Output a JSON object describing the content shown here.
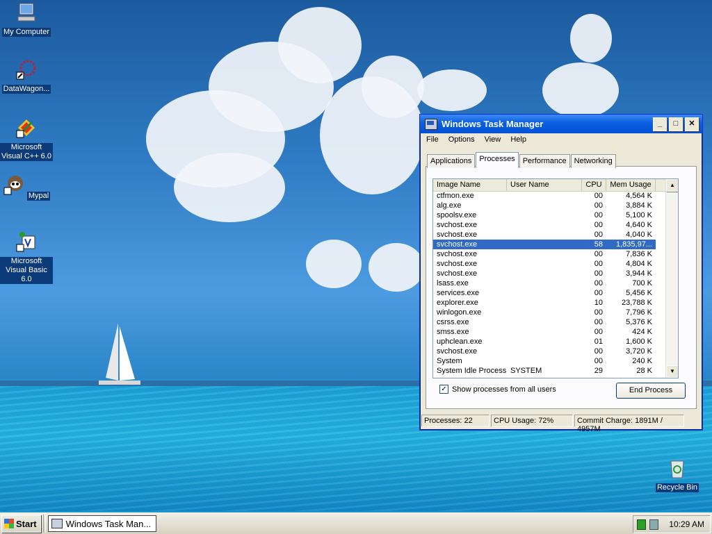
{
  "desktop": {
    "icons": [
      {
        "label": "My Computer"
      },
      {
        "label": "DataWagon..."
      },
      {
        "label": "Microsoft Visual C++ 6.0"
      },
      {
        "label": "Mypal"
      },
      {
        "label": "Microsoft Visual Basic 6.0"
      },
      {
        "label": "Recycle Bin"
      }
    ]
  },
  "window": {
    "title": "Windows Task Manager",
    "controls": {
      "minimize": "_",
      "maximize": "□",
      "close": "✕"
    },
    "menu": [
      "File",
      "Options",
      "View",
      "Help"
    ],
    "tabs": [
      {
        "label": "Applications"
      },
      {
        "label": "Processes",
        "active": true
      },
      {
        "label": "Performance"
      },
      {
        "label": "Networking"
      }
    ],
    "columns": [
      "Image Name",
      "User Name",
      "CPU",
      "Mem Usage"
    ],
    "processes": [
      {
        "name": "ctfmon.exe",
        "user": "",
        "cpu": "00",
        "mem": "4,564 K"
      },
      {
        "name": "alg.exe",
        "user": "",
        "cpu": "00",
        "mem": "3,884 K"
      },
      {
        "name": "spoolsv.exe",
        "user": "",
        "cpu": "00",
        "mem": "5,100 K"
      },
      {
        "name": "svchost.exe",
        "user": "",
        "cpu": "00",
        "mem": "4,640 K"
      },
      {
        "name": "svchost.exe",
        "user": "",
        "cpu": "00",
        "mem": "4,040 K"
      },
      {
        "name": "svchost.exe",
        "user": "",
        "cpu": "58",
        "mem": "1,835,97...",
        "selected": true
      },
      {
        "name": "svchost.exe",
        "user": "",
        "cpu": "00",
        "mem": "7,836 K"
      },
      {
        "name": "svchost.exe",
        "user": "",
        "cpu": "00",
        "mem": "4,804 K"
      },
      {
        "name": "svchost.exe",
        "user": "",
        "cpu": "00",
        "mem": "3,944 K"
      },
      {
        "name": "lsass.exe",
        "user": "",
        "cpu": "00",
        "mem": "700 K"
      },
      {
        "name": "services.exe",
        "user": "",
        "cpu": "00",
        "mem": "5,456 K"
      },
      {
        "name": "explorer.exe",
        "user": "",
        "cpu": "10",
        "mem": "23,788 K"
      },
      {
        "name": "winlogon.exe",
        "user": "",
        "cpu": "00",
        "mem": "7,796 K"
      },
      {
        "name": "csrss.exe",
        "user": "",
        "cpu": "00",
        "mem": "5,376 K"
      },
      {
        "name": "smss.exe",
        "user": "",
        "cpu": "00",
        "mem": "424 K"
      },
      {
        "name": "uphclean.exe",
        "user": "",
        "cpu": "01",
        "mem": "1,600 K"
      },
      {
        "name": "svchost.exe",
        "user": "",
        "cpu": "00",
        "mem": "3,720 K"
      },
      {
        "name": "System",
        "user": "",
        "cpu": "00",
        "mem": "240 K"
      },
      {
        "name": "System Idle Process",
        "user": "SYSTEM",
        "cpu": "29",
        "mem": "28 K"
      }
    ],
    "show_all_label": "Show processes from all users",
    "show_all_checked": true,
    "end_process_label": "End Process",
    "status": {
      "processes": "Processes: 22",
      "cpu": "CPU Usage: 72%",
      "commit": "Commit Charge: 1891M / 4957M"
    }
  },
  "taskbar": {
    "start_label": "Start",
    "task_label": "Windows Task Man...",
    "clock": "10:29 AM"
  }
}
